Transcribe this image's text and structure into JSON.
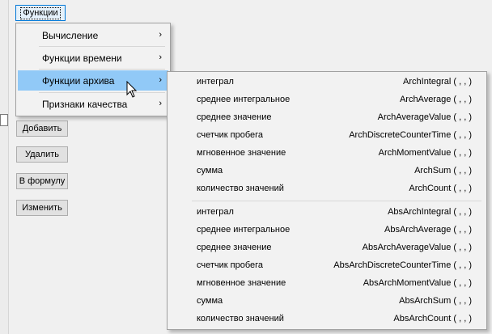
{
  "toolbar": {
    "functions_label": "Функции"
  },
  "side_buttons": [
    {
      "label": "Добавить"
    },
    {
      "label": "Удалить"
    },
    {
      "label": "В формулу"
    },
    {
      "label": "Изменить"
    }
  ],
  "menu": {
    "items": [
      {
        "label": "Вычисление",
        "submenu": true,
        "highlighted": false
      },
      {
        "label": "Функции времени",
        "submenu": true,
        "highlighted": false
      },
      {
        "label": "Функции архива",
        "submenu": true,
        "highlighted": true
      },
      {
        "label": "Признаки качества",
        "submenu": true,
        "highlighted": false
      }
    ],
    "arrow_glyph": "›"
  },
  "submenu": {
    "group1": [
      {
        "name": "интеграл",
        "fn": "ArchIntegral ( , , )"
      },
      {
        "name": "среднее интегральное",
        "fn": "ArchAverage ( , , )"
      },
      {
        "name": "среднее значение",
        "fn": "ArchAverageValue ( , , )"
      },
      {
        "name": "счетчик пробега",
        "fn": "ArchDiscreteCounterTime ( , , )"
      },
      {
        "name": "мгновенное значение",
        "fn": "ArchMomentValue ( , , )"
      },
      {
        "name": "сумма",
        "fn": "ArchSum ( , , )"
      },
      {
        "name": "количество значений",
        "fn": "ArchCount ( , , )"
      }
    ],
    "group2": [
      {
        "name": "интеграл",
        "fn": "AbsArchIntegral ( , , )"
      },
      {
        "name": "среднее интегральное",
        "fn": "AbsArchAverage ( , , )"
      },
      {
        "name": "среднее значение",
        "fn": "AbsArchAverageValue ( , , )"
      },
      {
        "name": "счетчик пробега",
        "fn": "AbsArchDiscreteCounterTime ( , , )"
      },
      {
        "name": "мгновенное значение",
        "fn": "AbsArchMomentValue ( , , )"
      },
      {
        "name": "сумма",
        "fn": "AbsArchSum ( , , )"
      },
      {
        "name": "количество значений",
        "fn": "AbsArchCount ( , , )"
      }
    ]
  },
  "colors": {
    "highlight": "#91c9f7",
    "menu_bg": "#f2f2f2",
    "focus_border": "#0078d7"
  }
}
